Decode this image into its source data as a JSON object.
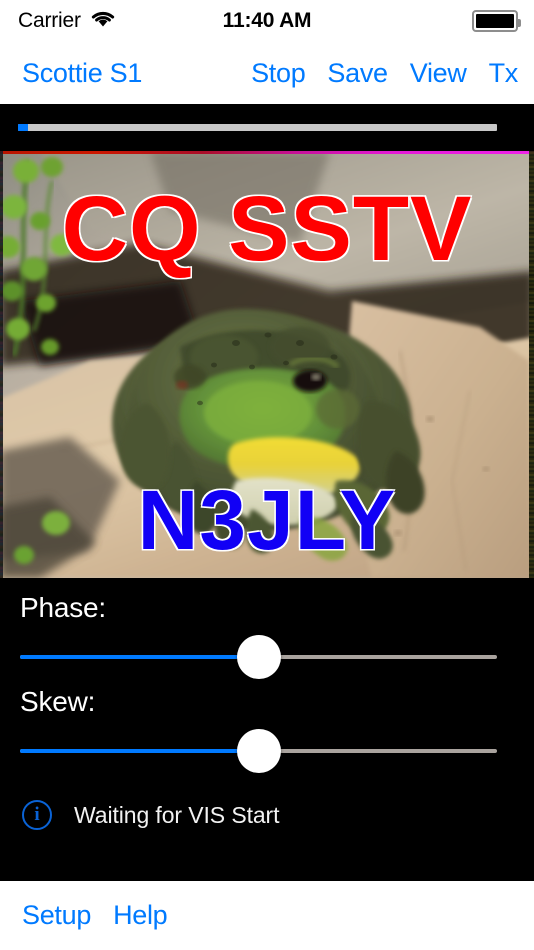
{
  "status_bar": {
    "carrier": "Carrier",
    "wifi_icon": "wifi-icon",
    "time": "11:40 AM",
    "battery_icon": "battery-full-icon"
  },
  "nav_bar": {
    "mode_button": "Scottie S1",
    "actions": [
      {
        "label": "Stop",
        "name": "stop-button"
      },
      {
        "label": "Save",
        "name": "save-button"
      },
      {
        "label": "View",
        "name": "view-button"
      },
      {
        "label": "Tx",
        "name": "tx-button"
      }
    ]
  },
  "progress": {
    "percent": 2,
    "fill_color": "#007aff",
    "track_color": "#c8c8c8"
  },
  "sstv_image": {
    "overlay_top_text": "CQ SSTV",
    "overlay_top_color": "#ff0000",
    "overlay_callsign": "N3JLY",
    "overlay_callsign_color": "#1100f5",
    "description": "Photo of a green bullfrog with a yellow throat sitting on a tan sandstone rock, green berry foliage at left, dark shadow behind",
    "sync_line_color": "#ee22e8"
  },
  "controls": {
    "phase": {
      "label": "Phase:",
      "value_percent": 50,
      "fill_color": "#007aff",
      "track_color": "#a9a39e"
    },
    "skew": {
      "label": "Skew:",
      "value_percent": 50,
      "fill_color": "#007aff",
      "track_color": "#a9a39e"
    }
  },
  "status_row": {
    "icon": "info-circle-icon",
    "icon_glyph": "i",
    "icon_color": "#0a63d6",
    "message": "Waiting for VIS Start"
  },
  "toolbar": {
    "setup_label": "Setup",
    "help_label": "Help"
  },
  "theme": {
    "accent_blue": "#007aff",
    "body_background": "#000000",
    "bar_background": "#ffffff"
  }
}
